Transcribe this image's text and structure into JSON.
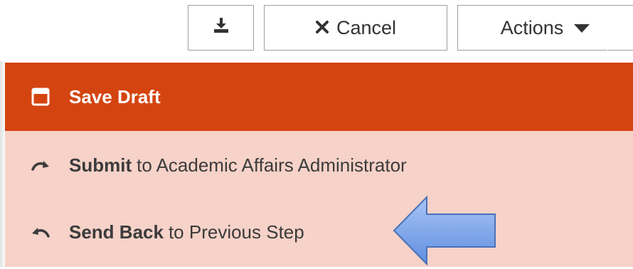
{
  "toolbar": {
    "download_icon": "download-icon",
    "cancel_label": "Cancel",
    "cancel_icon": "close-icon",
    "actions_label": "Actions",
    "actions_icon": "caret-down-icon"
  },
  "actions_menu": {
    "items": [
      {
        "icon": "save-icon",
        "bold": "Save Draft",
        "rest": ""
      },
      {
        "icon": "redo-arrow-icon",
        "bold": "Submit",
        "rest": "to Academic Affairs Administrator"
      },
      {
        "icon": "undo-arrow-icon",
        "bold": "Send Back",
        "rest": "to Previous Step"
      }
    ]
  },
  "colors": {
    "highlight": "#d44410",
    "menu_background": "#f6d2c8",
    "annotation_arrow": "#6f9be8"
  }
}
